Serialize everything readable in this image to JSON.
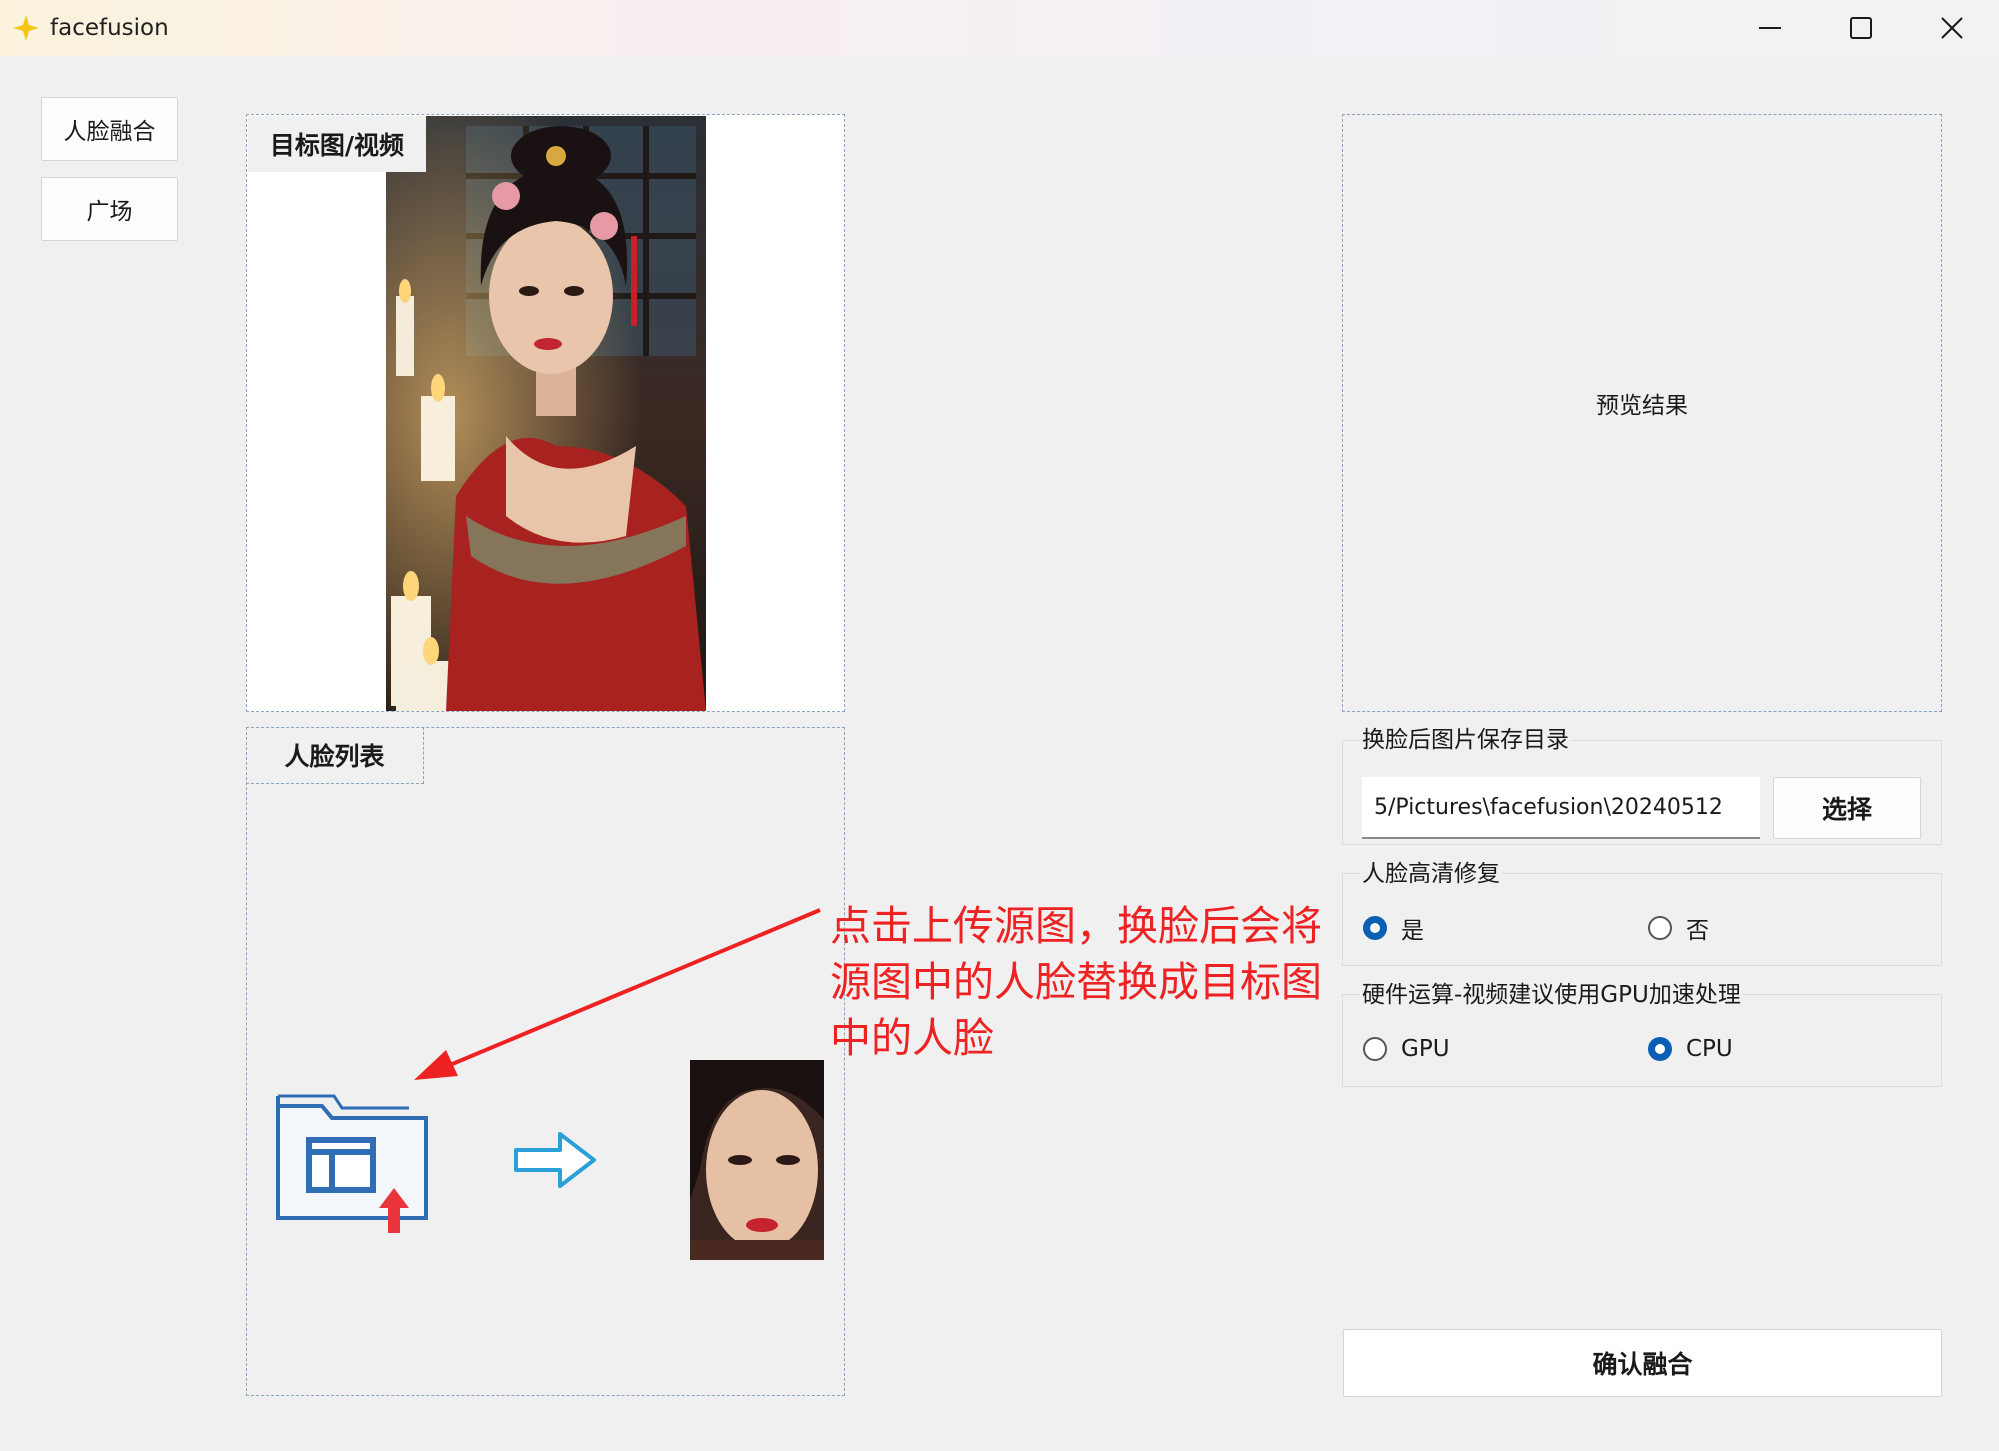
{
  "window": {
    "title": "facefusion",
    "icon": "sparkle-icon",
    "controls": [
      "minimize-icon",
      "maximize-icon",
      "close-icon"
    ]
  },
  "nav": {
    "items": [
      {
        "label": "人脸融合"
      },
      {
        "label": "广场"
      }
    ]
  },
  "target": {
    "label": "目标图/视频"
  },
  "faces": {
    "label": "人脸列表",
    "upload_icon": "folder-upload-icon",
    "arrow_icon": "right-arrow-icon"
  },
  "annotation": {
    "text": "点击上传源图，换脸后会将源图中的人脸替换成目标图中的人脸",
    "color": "#ee2222"
  },
  "preview": {
    "label": "预览结果"
  },
  "save": {
    "legend": "换脸后图片保存目录",
    "path_value": "5/Pictures\\facefusion\\20240512",
    "choose_label": "选择"
  },
  "enhance": {
    "legend": "人脸高清修复",
    "options": [
      {
        "label": "是",
        "selected": true
      },
      {
        "label": "否",
        "selected": false
      }
    ]
  },
  "hardware": {
    "legend": "硬件运算-视频建议使用GPU加速处理",
    "options": [
      {
        "label": "GPU",
        "selected": false
      },
      {
        "label": "CPU",
        "selected": true
      }
    ]
  },
  "confirm": {
    "label": "确认融合"
  },
  "colors": {
    "accent": "#0a5fb4",
    "background": "#f0f0f0"
  }
}
